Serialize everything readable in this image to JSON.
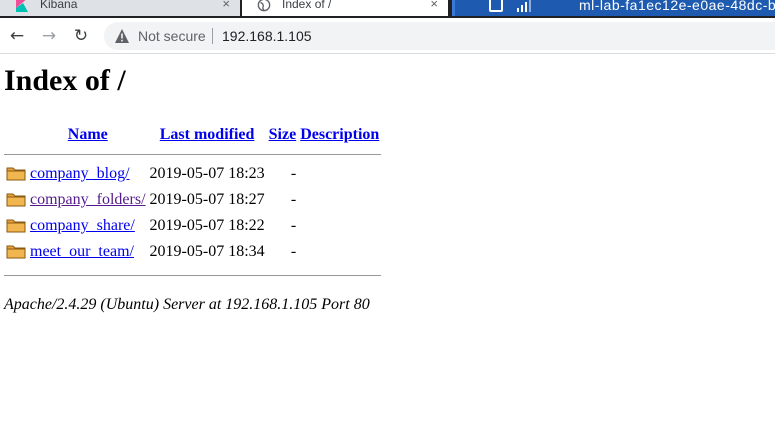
{
  "browser": {
    "tabs": [
      {
        "title": "Kibana",
        "active": false
      },
      {
        "title": "Index of /",
        "active": true
      }
    ],
    "close_glyph": "×",
    "remote_session": {
      "host": "ml-lab-fa1ec12e-e0ae-48dc-b"
    },
    "security_label": "Not secure",
    "url": "192.168.1.105"
  },
  "page": {
    "heading": "Index of /",
    "columns": {
      "name": "Name",
      "last_modified": "Last modified",
      "size": "Size",
      "description": "Description"
    },
    "rows": [
      {
        "name": "company_blog/",
        "modified": "2019-05-07 18:23",
        "size": "-",
        "description": "",
        "icon": "folder-icon"
      },
      {
        "name": "company_folders/",
        "modified": "2019-05-07 18:27",
        "size": "-",
        "description": "",
        "icon": "folder-icon"
      },
      {
        "name": "company_share/",
        "modified": "2019-05-07 18:22",
        "size": "-",
        "description": "",
        "icon": "folder-icon"
      },
      {
        "name": "meet_our_team/",
        "modified": "2019-05-07 18:34",
        "size": "-",
        "description": "",
        "icon": "folder-icon"
      }
    ],
    "footer": "Apache/2.4.29 (Ubuntu) Server at 192.168.1.105 Port 80"
  },
  "colors": {
    "link": "#0000ee",
    "visited_link": "#551a8b",
    "folder": "#e8a23c",
    "remote_bar": "#1e5bb0"
  }
}
